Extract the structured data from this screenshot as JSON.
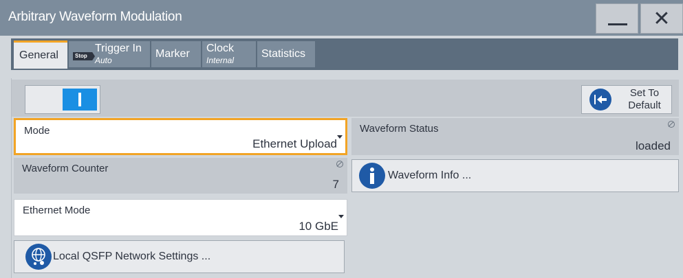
{
  "window": {
    "title": "Arbitrary Waveform Modulation",
    "minimize_icon": "minimize-icon",
    "close_label": "✕"
  },
  "tabs": [
    {
      "label": "General",
      "sub": "",
      "active": true
    },
    {
      "label": "Trigger In",
      "sub": "Auto",
      "badge": "Stop",
      "active": false
    },
    {
      "label": "Marker",
      "sub": "",
      "active": false
    },
    {
      "label": "Clock",
      "sub": "Internal",
      "active": false
    },
    {
      "label": "Statistics",
      "sub": "",
      "active": false
    }
  ],
  "state_toggle": {
    "on": true,
    "icon": "power-on-icon"
  },
  "set_to_default": {
    "line1": "Set To",
    "line2": "Default",
    "icon": "arrow-left-icon"
  },
  "fields": {
    "mode": {
      "label": "Mode",
      "value": "Ethernet Upload"
    },
    "waveform_status": {
      "label": "Waveform Status",
      "value": "loaded"
    },
    "waveform_counter": {
      "label": "Waveform Counter",
      "value": "7"
    },
    "ethernet_mode": {
      "label": "Ethernet Mode",
      "value": "10 GbE"
    }
  },
  "buttons": {
    "waveform_info": {
      "label": "Waveform Info ...",
      "icon": "info-icon"
    },
    "qsfp_settings": {
      "label": "Local QSFP Network Settings ...",
      "icon": "network-globe-icon"
    }
  },
  "colors": {
    "accent": "#f2a425",
    "toggle_on": "#1a8fe3",
    "icon_blue": "#1f5aa6",
    "titlebar": "#7c8c9c"
  }
}
